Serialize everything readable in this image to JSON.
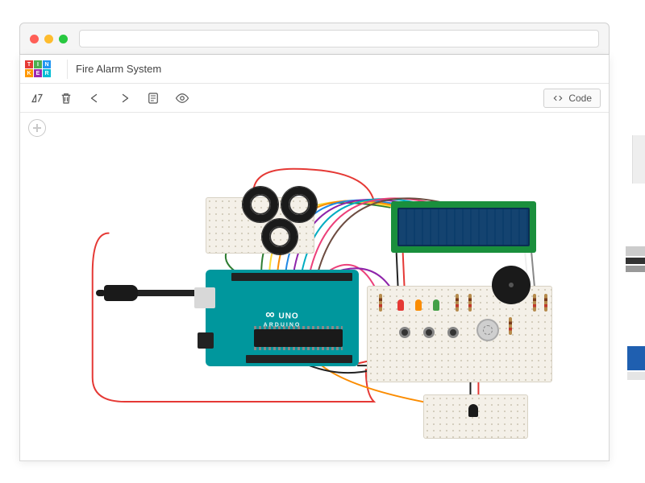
{
  "browser": {
    "traffic_lights": [
      "close",
      "minimize",
      "zoom"
    ]
  },
  "app": {
    "logo_letters": [
      "T",
      "I",
      "N",
      "K",
      "E",
      "R"
    ],
    "logo_colors": [
      "#e53935",
      "#4caf50",
      "#2196f3",
      "#ff9800",
      "#9c27b0",
      "#00bcd4"
    ],
    "project_title": "Fire Alarm System"
  },
  "toolbar": {
    "mirror_tooltip": "Mirror",
    "delete_tooltip": "Delete",
    "undo_tooltip": "Undo",
    "redo_tooltip": "Redo",
    "notes_tooltip": "Annotations",
    "visibility_tooltip": "Toggle visibility",
    "code_label": "Code"
  },
  "canvas": {
    "fit_tooltip": "Zoom to fit"
  },
  "components": {
    "arduino": {
      "label_top": "UNO",
      "label_brand": "ARDUINO",
      "infinity": "∞"
    },
    "lcd": {
      "type": "16x2 LCD"
    },
    "buzzer": {
      "type": "Piezo"
    },
    "leds": [
      "red",
      "orange",
      "green"
    ],
    "pushbuttons": 3,
    "neopixel_rings": 3,
    "resistors": 6,
    "gas_sensor": "round sensor",
    "tmp_sensor": "TMP36",
    "breadboards": [
      "top-small",
      "main",
      "bottom-small"
    ],
    "usb_cable": "USB-B"
  },
  "wire_colors": {
    "power": "#e53935",
    "ground": "#222222",
    "green": "#2e7d32",
    "blue": "#1e88e5",
    "yellow": "#fdd835",
    "orange": "#fb8c00",
    "purple": "#8e24aa",
    "pink": "#ec407a",
    "cyan": "#00acc1",
    "brown": "#6d4c41",
    "white": "#eeeeee",
    "gray": "#888888"
  }
}
